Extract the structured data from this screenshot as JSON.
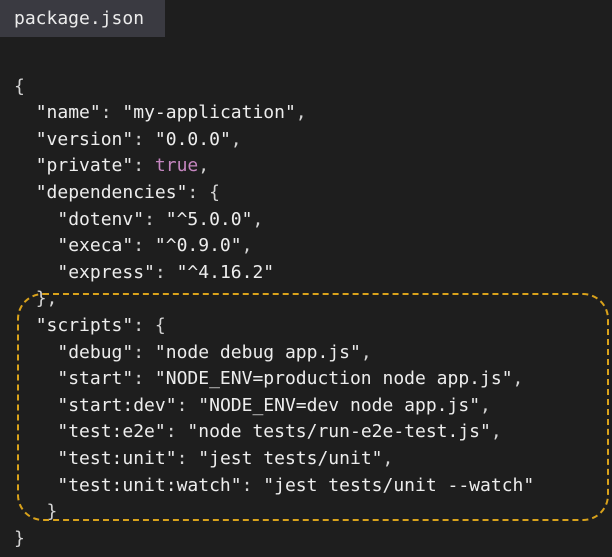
{
  "tab": {
    "filename": "package.json"
  },
  "code": {
    "open_brace": "{",
    "name_key": "\"name\"",
    "name_value": "\"my-application\"",
    "version_key": "\"version\"",
    "version_value": "\"0.0.0\"",
    "private_key": "\"private\"",
    "private_value": "true",
    "dependencies_key": "\"dependencies\"",
    "dotenv_key": "\"dotenv\"",
    "dotenv_value": "\"^5.0.0\"",
    "execa_key": "\"execa\"",
    "execa_value": "\"^0.9.0\"",
    "express_key": "\"express\"",
    "express_value": "\"^4.16.2\"",
    "deps_close": "},",
    "scripts_key": "\"scripts\"",
    "debug_key": "\"debug\"",
    "debug_value": "\"node debug app.js\"",
    "start_key": "\"start\"",
    "start_value": "\"NODE_ENV=production node app.js\"",
    "start_dev_key": "\"start:dev\"",
    "start_dev_value": "\"NODE_ENV=dev node app.js\"",
    "test_e2e_key": "\"test:e2e\"",
    "test_e2e_value": "\"node tests/run-e2e-test.js\"",
    "test_unit_key": "\"test:unit\"",
    "test_unit_value": "\"jest tests/unit\"",
    "test_unit_watch_key": "\"test:unit:watch\"",
    "test_unit_watch_value": "\"jest tests/unit --watch\"",
    "scripts_close": "}",
    "close_brace": "}"
  },
  "colors": {
    "background": "#1e1e1e",
    "tab_background": "#3a3a41",
    "text": "#ededed",
    "keyword": "#c586c0",
    "highlight_border": "#d9a21b"
  }
}
